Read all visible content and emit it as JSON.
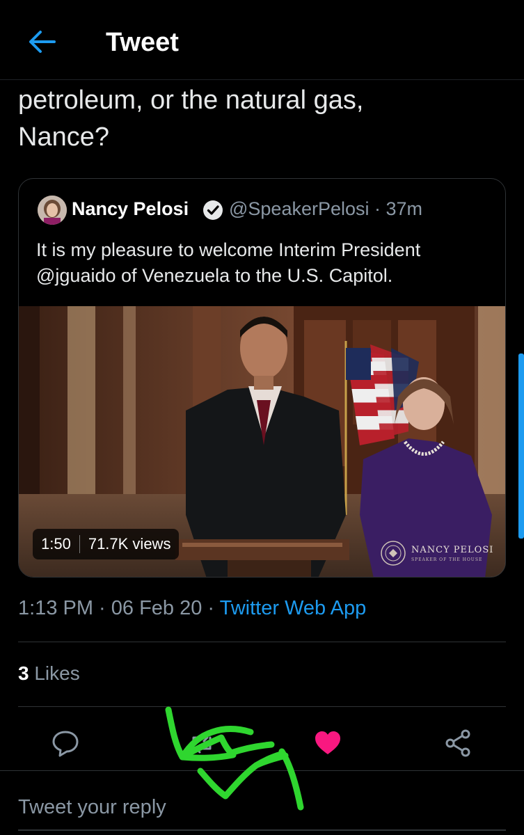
{
  "header": {
    "title": "Tweet",
    "back_icon": "arrow-left-icon"
  },
  "tweet": {
    "text": "petroleum, or the natural gas,\nNance?",
    "timestamp": "1:13 PM · 06 Feb 20 · ",
    "source": "Twitter Web App",
    "likes_count": "3",
    "likes_label": " Likes"
  },
  "quoted_tweet": {
    "name": "Nancy Pelosi",
    "handle_time": "@SpeakerPelosi · 37m",
    "text": "It is my pleasure to welcome Interim President @jguaido of Venezuela to the U.S. Capitol.",
    "video_duration": "1:50",
    "video_views": "71.7K views",
    "watermark": "NANCY PELOSI",
    "watermark_sub": "SPEAKER OF THE HOUSE"
  },
  "actions": {
    "reply_icon": "comment-icon",
    "retweet_icon": "retweet-icon",
    "like_icon": "heart-icon",
    "share_icon": "share-icon"
  },
  "reply": {
    "placeholder": "Tweet your reply"
  },
  "colors": {
    "accent": "#1d9bf0",
    "like": "#f91880",
    "background": "#000000",
    "secondary_text": "#8b98a5",
    "scribble": "#2fd62f"
  }
}
